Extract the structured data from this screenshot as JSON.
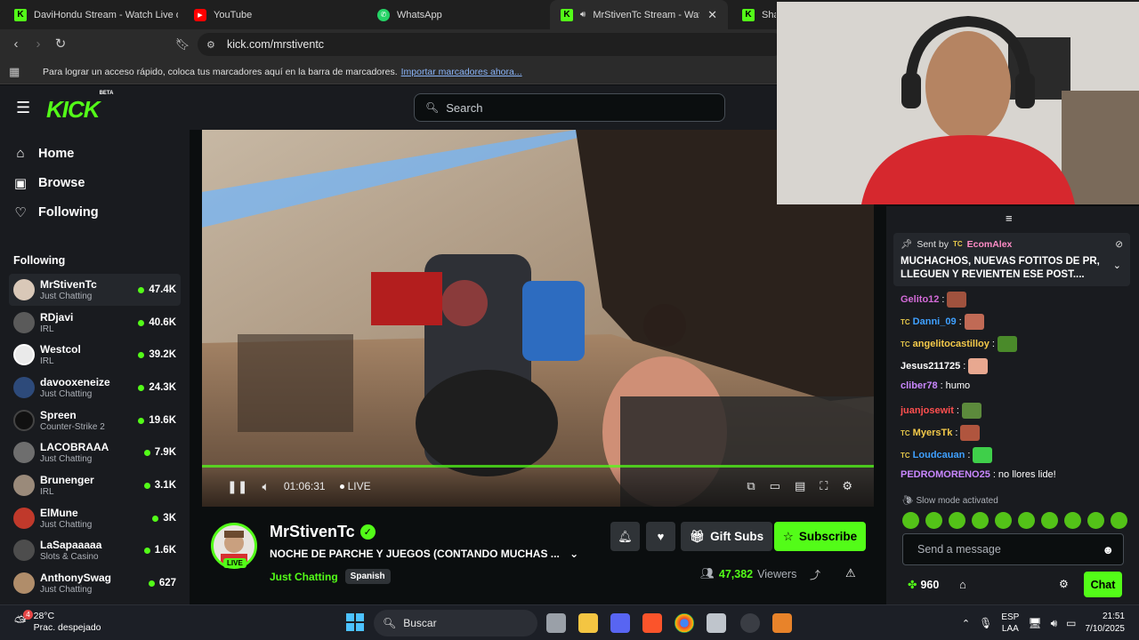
{
  "browser": {
    "tabs": [
      {
        "title": "DaviHondu Stream - Watch Live on K",
        "favicon": "kick"
      },
      {
        "title": "YouTube",
        "favicon": "youtube"
      },
      {
        "title": "WhatsApp",
        "favicon": "whatsapp"
      },
      {
        "title": "MrStivenTc Stream - Watch Li",
        "favicon": "kick",
        "active": true
      },
      {
        "title": "Shar",
        "favicon": "kick"
      }
    ],
    "url": "kick.com/mrstiventc",
    "bookmarks_text": "Para lograr un acceso rápido, coloca tus marcadores aquí en la barra de marcadores.",
    "bookmarks_link": "Importar marcadores ahora..."
  },
  "kick": {
    "logo": "KICK",
    "logo_badge": "BETA",
    "search_placeholder": "Search",
    "accent": "#53fc18"
  },
  "sidebar": {
    "nav": [
      {
        "label": "Home",
        "icon": "home-icon"
      },
      {
        "label": "Browse",
        "icon": "browse-icon"
      },
      {
        "label": "Following",
        "icon": "heart-icon"
      }
    ],
    "following_title": "Following",
    "channels": [
      {
        "name": "MrStivenTc",
        "category": "Just Chatting",
        "viewers": "47.4K",
        "active": true
      },
      {
        "name": "RDjavi",
        "category": "IRL",
        "viewers": "40.6K"
      },
      {
        "name": "Westcol",
        "category": "IRL",
        "viewers": "39.2K"
      },
      {
        "name": "davooxeneize",
        "category": "Just Chatting",
        "viewers": "24.3K"
      },
      {
        "name": "Spreen",
        "category": "Counter-Strike 2",
        "viewers": "19.6K"
      },
      {
        "name": "LACOBRAAA",
        "category": "Just Chatting",
        "viewers": "7.9K"
      },
      {
        "name": "Brunenger",
        "category": "IRL",
        "viewers": "3.1K"
      },
      {
        "name": "ElMune",
        "category": "Just Chatting",
        "viewers": "3K"
      },
      {
        "name": "LaSapaaaaa",
        "category": "Slots & Casino",
        "viewers": "1.6K"
      },
      {
        "name": "AnthonySwag",
        "category": "Just Chatting",
        "viewers": "627"
      }
    ]
  },
  "player": {
    "time": "01:06:31",
    "live_label": "LIVE"
  },
  "stream": {
    "channel": "MrStivenTc",
    "live_badge": "LIVE",
    "title": "NOCHE DE PARCHE Y JUEGOS (CONTANDO MUCHAS ...",
    "category": "Just Chatting",
    "language": "Spanish",
    "gift_label": "Gift Subs",
    "subscribe_label": "Subscribe",
    "viewers": "47,382",
    "viewers_label": "Viewers"
  },
  "chat": {
    "pinned": {
      "sent_by": "Sent by",
      "user": "EcomAlex",
      "message": "MUCHACHOS, NUEVAS FOTITOS DE PR, LLEGUEN Y REVIENTEN ESE POST...."
    },
    "messages": [
      {
        "user": "Gelito12",
        "color": "#d36bd8",
        "text": "",
        "tc": false
      },
      {
        "user": "Danni_09",
        "color": "#3fa0ff",
        "text": "",
        "tc": true
      },
      {
        "user": "angelitocastilloy",
        "color": "#f3c94a",
        "text": "",
        "tc": true
      },
      {
        "user": "Jesus211725",
        "color": "#ffffff",
        "text": "",
        "tc": false
      },
      {
        "user": "cliber78",
        "color": "#c987ff",
        "text": "humo",
        "tc": false
      },
      {
        "user": "juanjosewit",
        "color": "#ff4f4f",
        "text": "",
        "tc": false
      },
      {
        "user": "MyersTk",
        "color": "#f3c94a",
        "text": "",
        "tc": true
      },
      {
        "user": "Loudcauan",
        "color": "#3fa0ff",
        "text": "",
        "tc": true
      },
      {
        "user": "PEDROMORENO25",
        "color": "#c987ff",
        "text": "no llores lide!",
        "tc": false
      }
    ],
    "slow_mode": "Slow mode activated",
    "input_placeholder": "Send a message",
    "points": "960",
    "chat_button": "Chat"
  },
  "taskbar": {
    "temp": "28°C",
    "weather": "Prac. despejado",
    "weather_badge": "4",
    "search": "Buscar",
    "lang1": "ESP",
    "lang2": "LAA",
    "time": "21:51",
    "date": "7/10/2025"
  }
}
